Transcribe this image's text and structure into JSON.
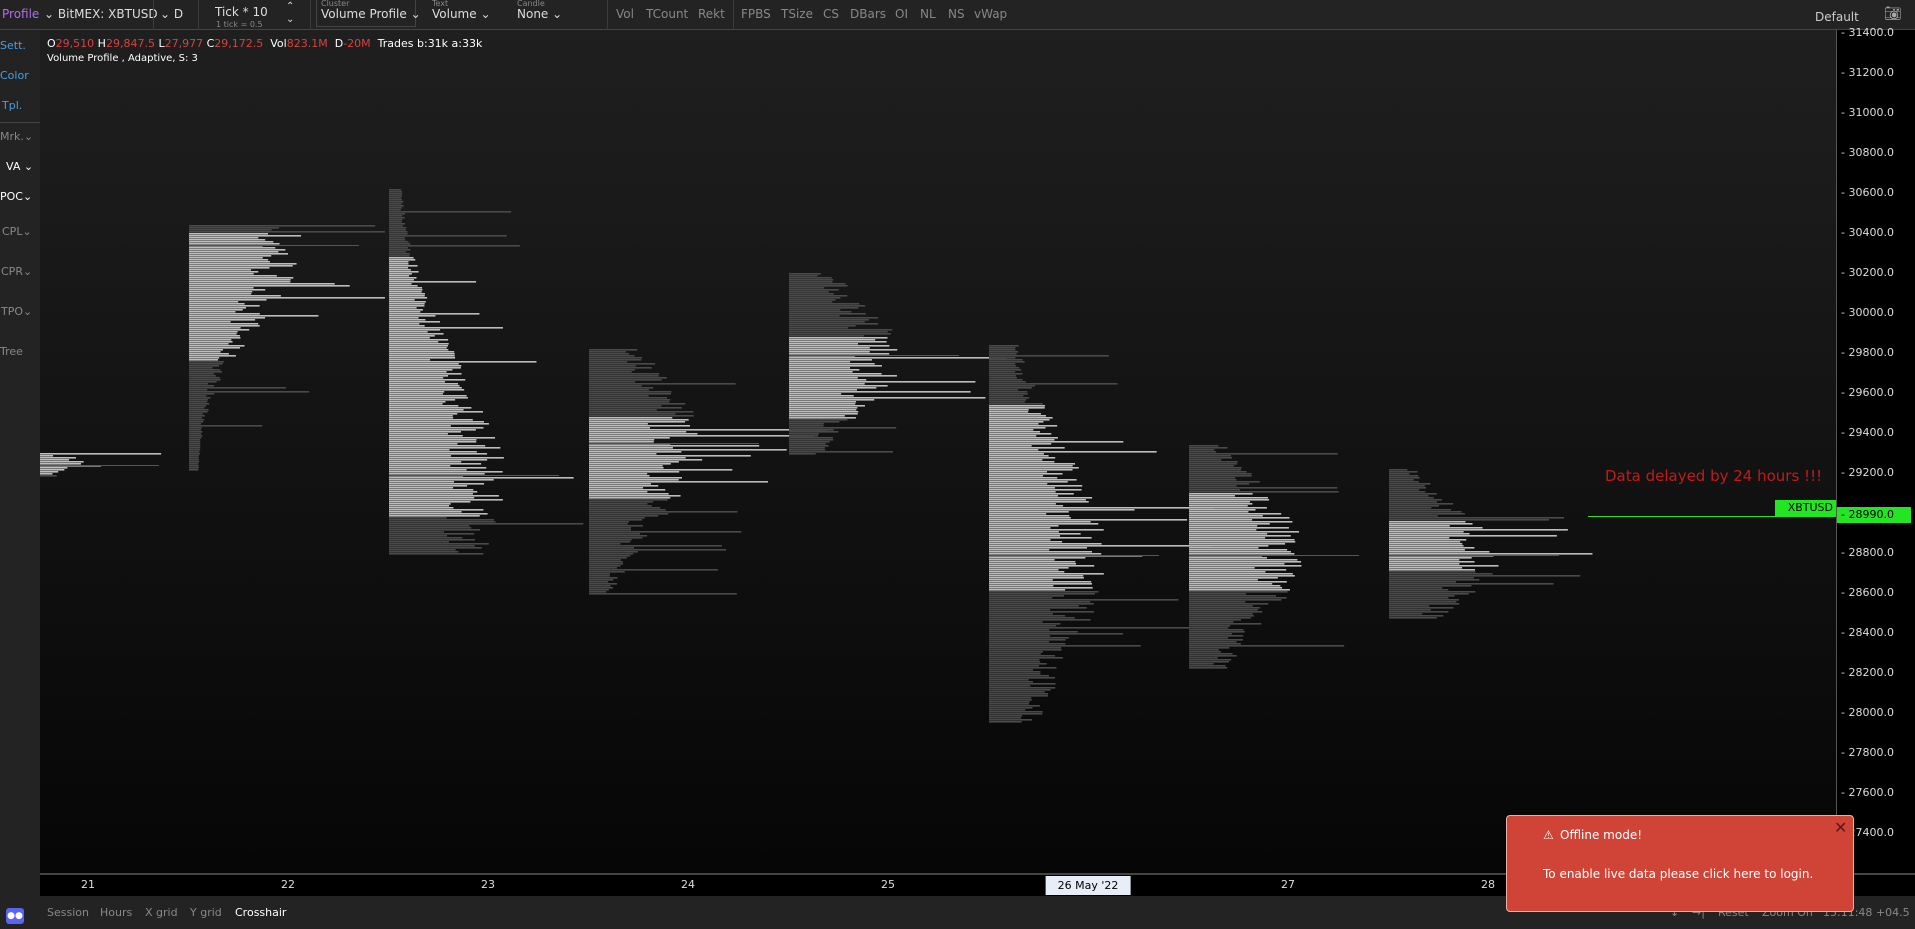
{
  "toolbar": {
    "profile": "Profile",
    "symbol": "BitMEX: XBTUSD",
    "timeframe": "D",
    "tick": "Tick * 10",
    "tick_sub": "1 tick = 0.5",
    "cluster_label": "Cluster",
    "cluster_value": "Volume Profile",
    "text_label": "Text",
    "text_value": "Volume",
    "candle_label": "Candle",
    "candle_value": "None",
    "group1": [
      "Vol",
      "TCount",
      "Rekt"
    ],
    "group2": [
      "FPBS",
      "TSize",
      "CS",
      "DBars",
      "OI",
      "NL",
      "NS",
      "vWap"
    ],
    "layout": "Default"
  },
  "info": {
    "o_label": "O",
    "o": "29,510",
    "h_label": "H",
    "h": "29,847.5",
    "l_label": "L",
    "l": "27,977",
    "c_label": "C",
    "c": "29,172.5",
    "vol_label": "Vol",
    "vol": "823.1M",
    "d_label": "D",
    "d": "-20M",
    "trades": "Trades b:31k a:33k",
    "indicator": "Volume Profile , Adaptive, S: 3"
  },
  "sidebar": {
    "items": [
      "Sett.",
      "Color",
      "Tpl.",
      "Mrk.",
      "VA",
      "POC",
      "CPL",
      "CPR",
      "TPO",
      "Tree"
    ]
  },
  "price_axis": {
    "labels": [
      "31400.0",
      "31200.0",
      "31000.0",
      "30800.0",
      "30600.0",
      "30400.0",
      "30200.0",
      "30000.0",
      "29800.0",
      "29600.0",
      "29400.0",
      "29200.0",
      "29000.0",
      "28800.0",
      "28600.0",
      "28400.0",
      "28200.0",
      "28000.0",
      "27800.0",
      "27600.0",
      "27400.0"
    ],
    "current_price": "28990.0",
    "current_symbol": "XBTUSD"
  },
  "time_axis": {
    "labels": [
      "21",
      "22",
      "23",
      "24",
      "25",
      "26 May '22",
      "27",
      "28"
    ]
  },
  "delay_notice": "Data delayed by 24 hours !!!",
  "bottom": {
    "items": [
      "Session",
      "Hours",
      "X grid",
      "Y grid",
      "Crosshair"
    ],
    "right": [
      "↓",
      "→|",
      "Reset",
      "Zoom On",
      "15:11:48 +04.5"
    ]
  },
  "toast": {
    "title": "Offline mode!",
    "message": "To enable live data please click here to login."
  },
  "colors": {
    "poc": "#c0282a",
    "va": "#bdbdbd",
    "outside_va": "#4a4a4a",
    "current_price": "#22e622",
    "profile_accent": "#b46cf0",
    "link": "#4a9ee0"
  },
  "chart_data": {
    "type": "volume-profile",
    "price_range": [
      27300,
      31450
    ],
    "profiles": [
      {
        "day": "21",
        "high": 29380,
        "low": 29190,
        "va_high": 29380,
        "va_low": 29200,
        "poc": 29240
      },
      {
        "day": "22",
        "high": 30440,
        "low": 29220,
        "va_high": 30400,
        "va_low": 29770,
        "poc": 30340
      },
      {
        "day": "23",
        "high": 30620,
        "low": 28800,
        "va_high": 30280,
        "va_low": 28990,
        "poc": 29190
      },
      {
        "day": "24",
        "high": 29820,
        "low": 28600,
        "va_high": 29480,
        "va_low": 29080,
        "poc": 29350
      },
      {
        "day": "25",
        "high": 30200,
        "low": 29300,
        "va_high": 29880,
        "va_low": 29480,
        "poc": 29790
      },
      {
        "day": "26",
        "high": 29840,
        "low": 27960,
        "va_high": 29540,
        "va_low": 28620,
        "poc": 28790
      },
      {
        "day": "27",
        "high": 29340,
        "low": 28230,
        "va_high": 29100,
        "va_low": 28620,
        "poc": 28790
      },
      {
        "day": "28",
        "high": 29220,
        "low": 28480,
        "va_high": 28960,
        "va_low": 28720,
        "poc": 28790
      }
    ],
    "current_price": 28990
  }
}
